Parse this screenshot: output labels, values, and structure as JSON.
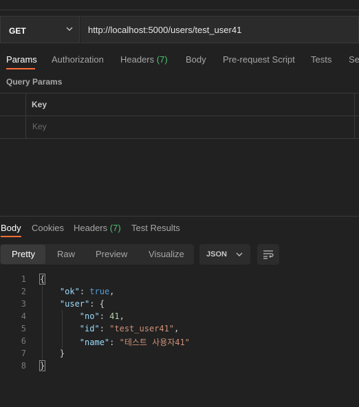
{
  "request": {
    "method": "GET",
    "url": "http://localhost:5000/users/test_user41"
  },
  "request_tabs": {
    "params": "Params",
    "authorization": "Authorization",
    "headers": "Headers",
    "headers_count": "(7)",
    "body": "Body",
    "prerequest": "Pre-request Script",
    "tests": "Tests",
    "settings_partial": "Set"
  },
  "query_params": {
    "title": "Query Params",
    "key_header": "Key",
    "key_placeholder": "Key"
  },
  "response_tabs": {
    "body": "Body",
    "cookies": "Cookies",
    "headers": "Headers",
    "headers_count": "(7)",
    "test_results": "Test Results"
  },
  "format": {
    "pretty": "Pretty",
    "raw": "Raw",
    "preview": "Preview",
    "visualize": "Visualize",
    "language": "JSON"
  },
  "response_body": {
    "line_numbers": [
      "1",
      "2",
      "3",
      "4",
      "5",
      "6",
      "7",
      "8"
    ],
    "ok_key": "\"ok\"",
    "ok_value": "true",
    "user_key": "\"user\"",
    "no_key": "\"no\"",
    "no_value": "41",
    "id_key": "\"id\"",
    "id_value": "\"test_user41\"",
    "name_key": "\"name\"",
    "name_value": "\"테스트 사용자41\""
  },
  "colors": {
    "accent": "#ff6c37",
    "count_green": "#4cc371",
    "background": "#212121"
  },
  "icons": [
    "chevron-down-icon",
    "wrap-lines-icon"
  ]
}
